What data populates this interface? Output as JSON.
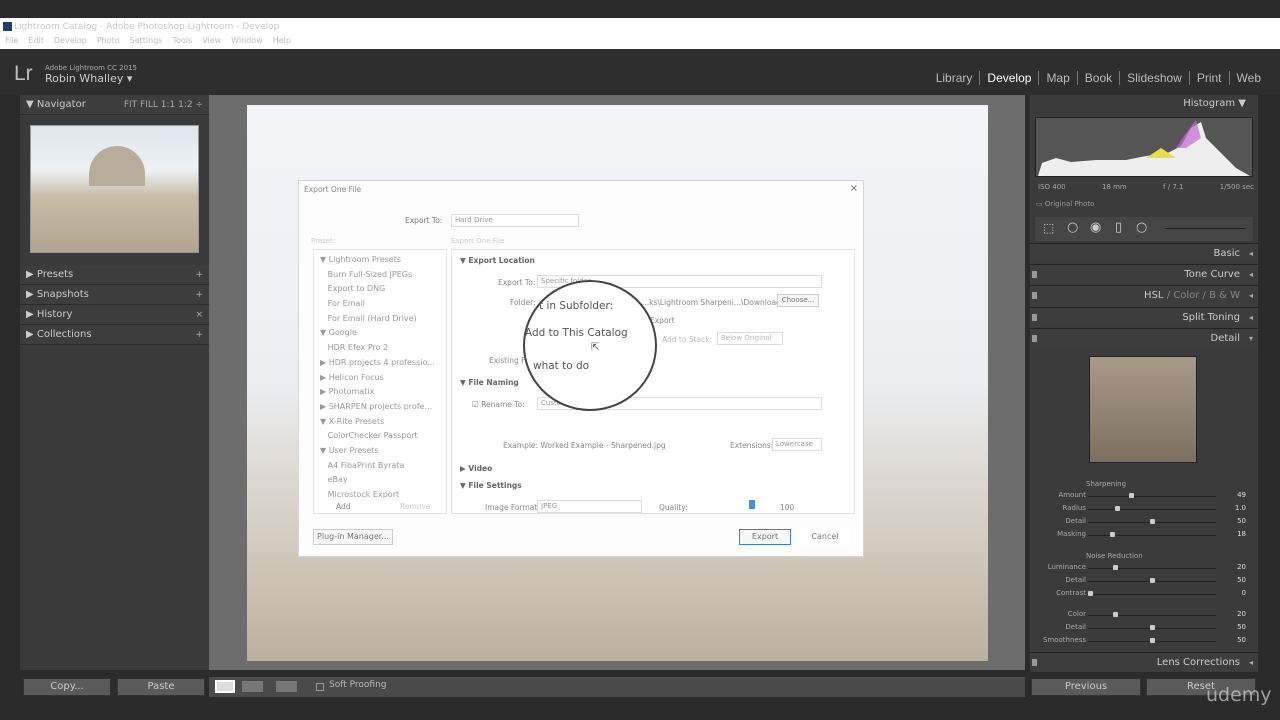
{
  "window": {
    "title": "Lightroom Catalog - Adobe Photoshop Lightroom - Develop"
  },
  "menu": [
    "File",
    "Edit",
    "Develop",
    "Photo",
    "Settings",
    "Tools",
    "View",
    "Window",
    "Help"
  ],
  "identity": {
    "logo": "Lr",
    "product": "Adobe Lightroom CC 2015",
    "user": "Robin Whalley ▾"
  },
  "modules": [
    "Library",
    "Develop",
    "Map",
    "Book",
    "Slideshow",
    "Print",
    "Web"
  ],
  "active_module": "Develop",
  "left_panel": {
    "navigator": "Navigator",
    "nav_zoom": "FIT  FILL  1:1  1:2 ÷",
    "sections": [
      {
        "label": "Presets",
        "action": "+"
      },
      {
        "label": "Snapshots",
        "action": "+"
      },
      {
        "label": "History",
        "action": "×"
      },
      {
        "label": "Collections",
        "action": "+"
      }
    ],
    "copy": "Copy...",
    "paste": "Paste"
  },
  "toolbar": {
    "soft_proofing": "Soft Proofing"
  },
  "dialog": {
    "title": "Export One File",
    "export_to_label": "Export To:",
    "export_to_value": "Hard Drive",
    "preset_label": "Preset:",
    "export_one_label": "Export One File",
    "presets": [
      "▼ Lightroom Presets",
      "   Burn Full-Sized JPEGs",
      "   Export to DNG",
      "   For Email",
      "   For Email (Hard Drive)",
      "▼ Google",
      "   HDR Efex Pro 2",
      "▶ HDR projects 4 professio...",
      "▶ Helicon Focus",
      "▶ Photomatix",
      "▶ SHARPEN projects profe...",
      "▼ X-Rite Presets",
      "   ColorChecker Passport",
      "▼ User Presets",
      "   A4 FibaPrint Byrata",
      "   eBay",
      "   Microstock Export"
    ],
    "add": "Add",
    "remove": "Remove",
    "plugin_manager": "Plug-in Manager...",
    "export_location": "Export Location",
    "export_to2_label": "Export To:",
    "export_to2_value": "Specific folder",
    "folder_label": "Folder:",
    "folder_value": "...ks\\Lightroom Sharpeni...\\Downloads",
    "choose": "Choose...",
    "subfolder_value": "Export",
    "add_to_stack": "Add to Stack:",
    "below_original": "Below Original",
    "existing_files": "Existing Files:",
    "file_naming": "File Naming",
    "rename_to": "Rename To:",
    "rename_value": "Custom",
    "example": "Example:  Worked Example - Sharpened.jpg",
    "extensions_label": "Extensions:",
    "extensions_value": "Lowercase",
    "video": "Video",
    "file_settings": "File Settings",
    "image_format_label": "Image Format:",
    "image_format_value": "JPEG",
    "quality_label": "Quality:",
    "quality_value": "100",
    "export_button": "Export",
    "cancel_button": "Cancel"
  },
  "magnifier": {
    "line1": "t in Subfolder:",
    "line2": "Add to This Catalog",
    "line3": "what to do"
  },
  "right_panel": {
    "histogram": "Histogram",
    "iso": "ISO 400",
    "focal": "18 mm",
    "aperture": "f / 7.1",
    "shutter": "1/500 sec",
    "original_photo": "Original Photo",
    "sections": [
      "Basic",
      "Tone Curve",
      "Split Toning",
      "Detail"
    ],
    "hsl": "HSL",
    "color": "Color",
    "bw": "B & W",
    "sharpening": "Sharpening",
    "sharpening_sliders": [
      {
        "label": "Amount",
        "value": "49",
        "pct": 0.33
      },
      {
        "label": "Radius",
        "value": "1.0",
        "pct": 0.22
      },
      {
        "label": "Detail",
        "value": "50",
        "pct": 0.5
      },
      {
        "label": "Masking",
        "value": "18",
        "pct": 0.18
      }
    ],
    "noise": "Noise Reduction",
    "noise_sliders": [
      {
        "label": "Luminance",
        "value": "20",
        "pct": 0.2
      },
      {
        "label": "Detail",
        "value": "50",
        "pct": 0.5
      },
      {
        "label": "Contrast",
        "value": "0",
        "pct": 0
      },
      {
        "label": "Color",
        "value": "20",
        "pct": 0.2
      },
      {
        "label": "Detail",
        "value": "50",
        "pct": 0.5
      },
      {
        "label": "Smoothness",
        "value": "50",
        "pct": 0.5
      }
    ],
    "lens": "Lens Corrections",
    "previous": "Previous",
    "reset": "Reset"
  },
  "watermark": "udemy"
}
